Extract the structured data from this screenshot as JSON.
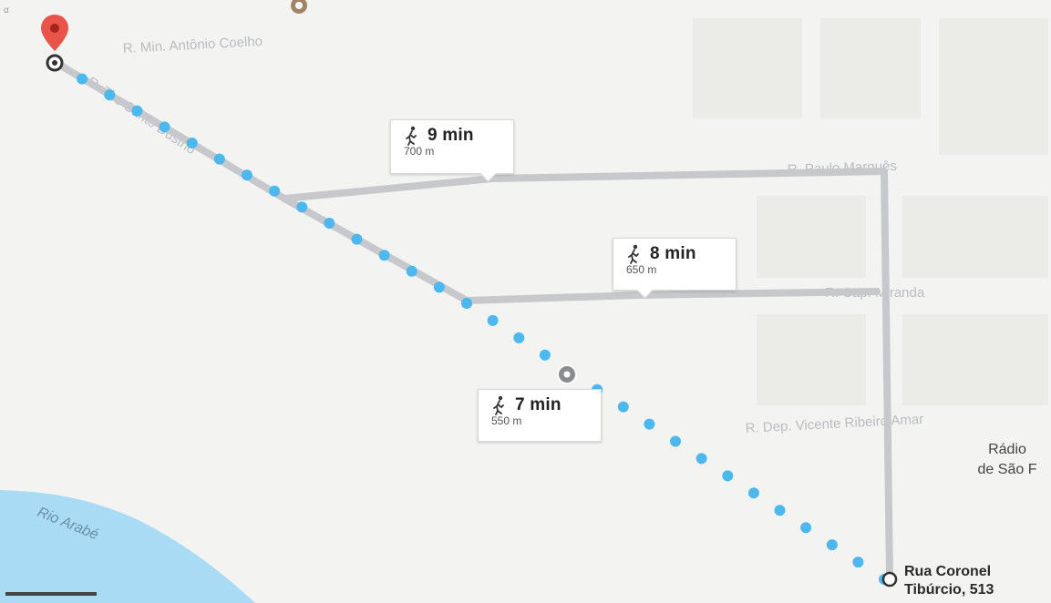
{
  "streets": {
    "min_antonio_coelho": "R. Min. Antônio Coelho",
    "diagonal": "R. Tiro Sahtô Dustrio",
    "paulo_marques": "R. Paulo Marquês",
    "cap_miranda": "R. Cap. Miranda",
    "dep_vicente": "R. Dep. Vicente Ribeiro Amar"
  },
  "river": {
    "label": "Rio Arabé"
  },
  "place": {
    "line1": "Rádio",
    "line2": "de São F"
  },
  "routes": [
    {
      "time": "9 min",
      "distance": "700 m"
    },
    {
      "time": "8 min",
      "distance": "650 m"
    },
    {
      "time": "7 min",
      "distance": "550 m"
    }
  ],
  "destination": {
    "line1": "Rua Coronel",
    "line2": "Tibúrcio, 513"
  },
  "icons": {
    "origin": "red-map-pin-icon",
    "walk": "walking-person-icon",
    "waypoint": "gray-pin-icon"
  },
  "colors": {
    "route_dots": "#4db8ee",
    "alt_route": "#c6c8cc",
    "origin_pin": "#e8544a",
    "river": "#a9dcf4"
  }
}
